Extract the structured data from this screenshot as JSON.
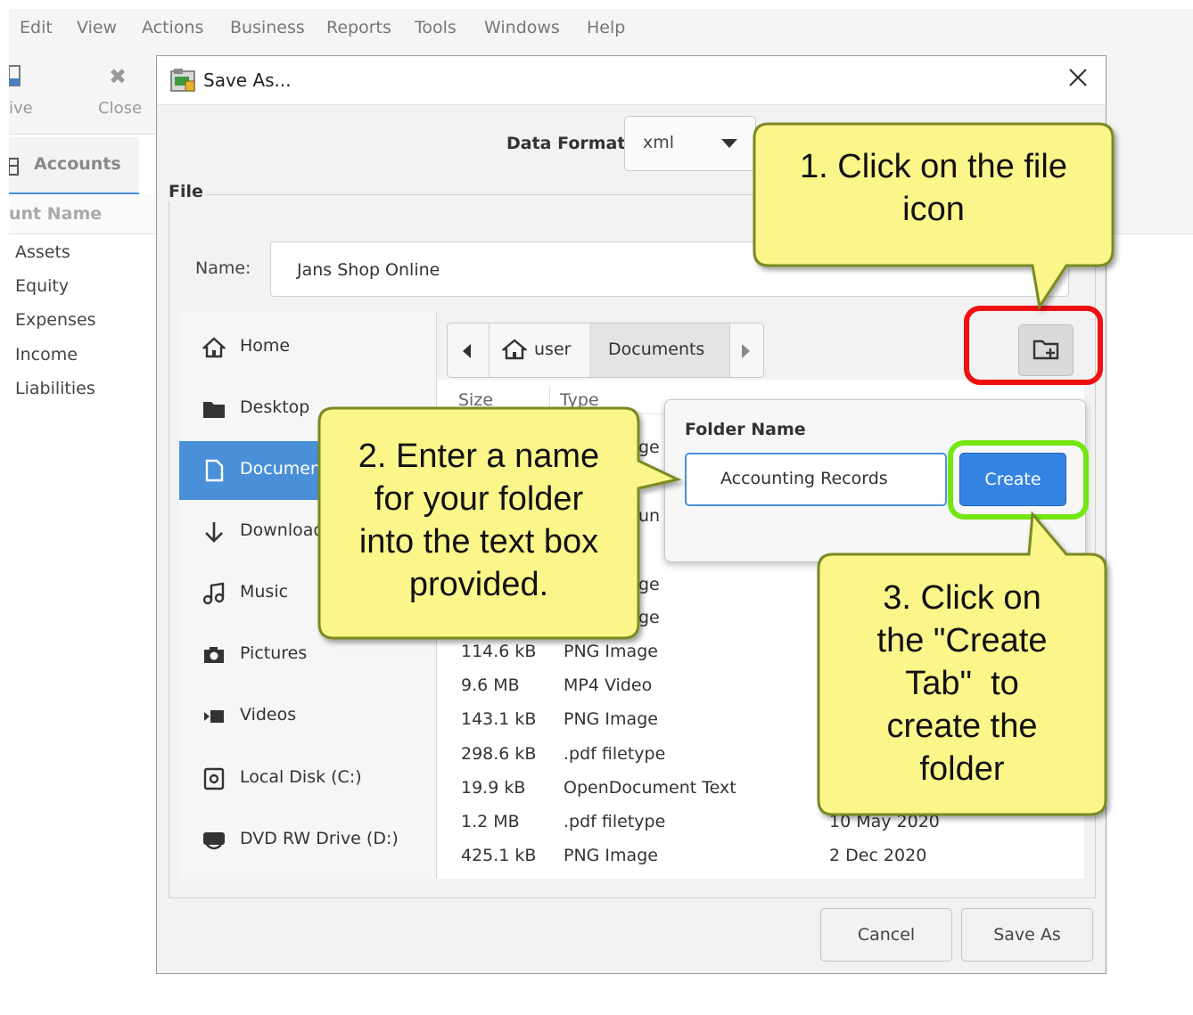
{
  "menubar": {
    "items": [
      "Edit",
      "View",
      "Actions",
      "Business",
      "Reports",
      "Tools",
      "Windows",
      "Help"
    ]
  },
  "toolbar": {
    "save_label": "ive",
    "close_label": "Close"
  },
  "accounts_tab": {
    "label": "Accounts",
    "column_header": "unt Name",
    "rows": [
      "Assets",
      "Equity",
      "Expenses",
      "Income",
      "Liabilities"
    ]
  },
  "dialog": {
    "title": "Save As...",
    "data_format_label": "Data Format",
    "data_format_value": "xml",
    "file_section_label": "File",
    "name_label": "Name:",
    "name_value": "Jans Shop Online",
    "places": [
      "Home",
      "Desktop",
      "Documents",
      "Downloads",
      "Music",
      "Pictures",
      "Videos",
      "Local Disk (C:)",
      "DVD RW Drive (D:)"
    ],
    "path": {
      "segments": [
        "user",
        "Documents"
      ]
    },
    "file_headers": {
      "size": "Size",
      "type": "Type"
    },
    "partial_cells": [
      "ge",
      "un",
      "ge",
      "ge"
    ],
    "files": [
      {
        "size": "114.6 kB",
        "type": "PNG Image",
        "modified": ""
      },
      {
        "size": "9.6 MB",
        "type": "MP4 Video",
        "modified": ""
      },
      {
        "size": "143.1 kB",
        "type": "PNG Image",
        "modified": ""
      },
      {
        "size": "298.6 kB",
        "type": ".pdf filetype",
        "modified": ""
      },
      {
        "size": "19.9 kB",
        "type": "OpenDocument Text",
        "modified": ""
      },
      {
        "size": "1.2 MB",
        "type": ".pdf filetype",
        "modified": "10 May 2020"
      },
      {
        "size": "425.1 kB",
        "type": "PNG Image",
        "modified": "2 Dec 2020"
      }
    ],
    "new_folder": {
      "title": "Folder Name",
      "value": "Accounting Records",
      "create_label": "Create"
    },
    "cancel_label": "Cancel",
    "save_label": "Save As"
  },
  "callouts": {
    "step1": [
      "1. Click on the file",
      "icon"
    ],
    "step2": [
      "2. Enter a name",
      "for your folder",
      "into the text box",
      "provided."
    ],
    "step3": [
      "3. Click on",
      "the \"Create",
      "Tab\"  to",
      "create the",
      "folder"
    ],
    "fill_color": "#fbf68a",
    "border_color": "#7a8a20"
  },
  "colors": {
    "accent": "#4a90d9",
    "highlight_red": "#ee1111",
    "highlight_green": "#74e614"
  }
}
